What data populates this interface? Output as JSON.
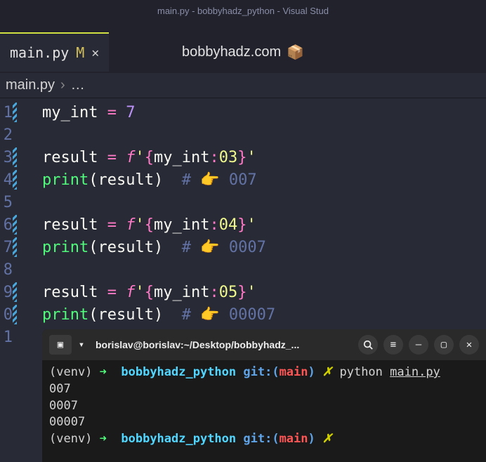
{
  "titleBar": "main.py - bobbyhadz_python - Visual Stud",
  "tab": {
    "filename": "main.py",
    "modified": "M",
    "close": "✕"
  },
  "centerOverlay": {
    "text": "bobbyhadz.com",
    "icon": "📦"
  },
  "breadcrumb": {
    "file": "main.py",
    "sep": "›",
    "rest": "…"
  },
  "code": {
    "lines": [
      {
        "num": "1",
        "marker": true,
        "tokens": [
          [
            "var",
            "my_int"
          ],
          [
            "plain",
            " "
          ],
          [
            "op",
            "="
          ],
          [
            "plain",
            " "
          ],
          [
            "num",
            "7"
          ]
        ]
      },
      {
        "num": "2",
        "marker": false,
        "tokens": []
      },
      {
        "num": "3",
        "marker": true,
        "tokens": [
          [
            "var",
            "result"
          ],
          [
            "plain",
            " "
          ],
          [
            "op",
            "="
          ],
          [
            "plain",
            " "
          ],
          [
            "fstr",
            "f"
          ],
          [
            "str",
            "'"
          ],
          [
            "strop",
            "{"
          ],
          [
            "var",
            "my_int"
          ],
          [
            "strop",
            ":"
          ],
          [
            "str",
            "03"
          ],
          [
            "strop",
            "}"
          ],
          [
            "str",
            "'"
          ]
        ]
      },
      {
        "num": "4",
        "marker": true,
        "tokens": [
          [
            "func",
            "print"
          ],
          [
            "paren",
            "("
          ],
          [
            "var",
            "result"
          ],
          [
            "paren",
            ")"
          ],
          [
            "plain",
            "  "
          ],
          [
            "comment",
            "# "
          ],
          [
            "emoji",
            "👉"
          ],
          [
            "comment",
            " 007"
          ]
        ]
      },
      {
        "num": "5",
        "marker": false,
        "tokens": []
      },
      {
        "num": "6",
        "marker": true,
        "tokens": [
          [
            "var",
            "result"
          ],
          [
            "plain",
            " "
          ],
          [
            "op",
            "="
          ],
          [
            "plain",
            " "
          ],
          [
            "fstr",
            "f"
          ],
          [
            "str",
            "'"
          ],
          [
            "strop",
            "{"
          ],
          [
            "var",
            "my_int"
          ],
          [
            "strop",
            ":"
          ],
          [
            "str",
            "04"
          ],
          [
            "strop",
            "}"
          ],
          [
            "str",
            "'"
          ]
        ]
      },
      {
        "num": "7",
        "marker": true,
        "tokens": [
          [
            "func",
            "print"
          ],
          [
            "paren",
            "("
          ],
          [
            "var",
            "result"
          ],
          [
            "paren",
            ")"
          ],
          [
            "plain",
            "  "
          ],
          [
            "comment",
            "# "
          ],
          [
            "emoji",
            "👉"
          ],
          [
            "comment",
            " 0007"
          ]
        ]
      },
      {
        "num": "8",
        "marker": false,
        "tokens": []
      },
      {
        "num": "9",
        "marker": true,
        "tokens": [
          [
            "var",
            "result"
          ],
          [
            "plain",
            " "
          ],
          [
            "op",
            "="
          ],
          [
            "plain",
            " "
          ],
          [
            "fstr",
            "f"
          ],
          [
            "str",
            "'"
          ],
          [
            "strop",
            "{"
          ],
          [
            "var",
            "my_int"
          ],
          [
            "strop",
            ":"
          ],
          [
            "str",
            "05"
          ],
          [
            "strop",
            "}"
          ],
          [
            "str",
            "'"
          ]
        ]
      },
      {
        "num": "0",
        "marker": true,
        "tokens": [
          [
            "func",
            "print"
          ],
          [
            "paren",
            "("
          ],
          [
            "var",
            "result"
          ],
          [
            "paren",
            ")"
          ],
          [
            "plain",
            "  "
          ],
          [
            "comment",
            "# "
          ],
          [
            "emoji",
            "👉"
          ],
          [
            "comment",
            " 00007"
          ]
        ]
      },
      {
        "num": "1",
        "marker": false,
        "tokens": []
      }
    ]
  },
  "terminal": {
    "newTabIcon": "▣",
    "dropdownIcon": "▾",
    "path": "borislav@borislav:~/Desktop/bobbyhadz_...",
    "searchIcon": "🔍",
    "menuIcon": "≡",
    "minIcon": "—",
    "maxIcon": "▢",
    "closeIcon": "✕",
    "lines": [
      {
        "type": "prompt",
        "venv": "(venv)",
        "arrow": "➜",
        "dir": "bobbyhadz_python",
        "gitLabel": "git:(",
        "branch": "main",
        "gitClose": ")",
        "x": "✗",
        "cmd": "python",
        "file": "main.py"
      },
      {
        "type": "output",
        "text": "007"
      },
      {
        "type": "output",
        "text": "0007"
      },
      {
        "type": "output",
        "text": "00007"
      },
      {
        "type": "prompt",
        "venv": "(venv)",
        "arrow": "➜",
        "dir": "bobbyhadz_python",
        "gitLabel": "git:(",
        "branch": "main",
        "gitClose": ")",
        "x": "✗",
        "cmd": "",
        "file": ""
      }
    ]
  }
}
